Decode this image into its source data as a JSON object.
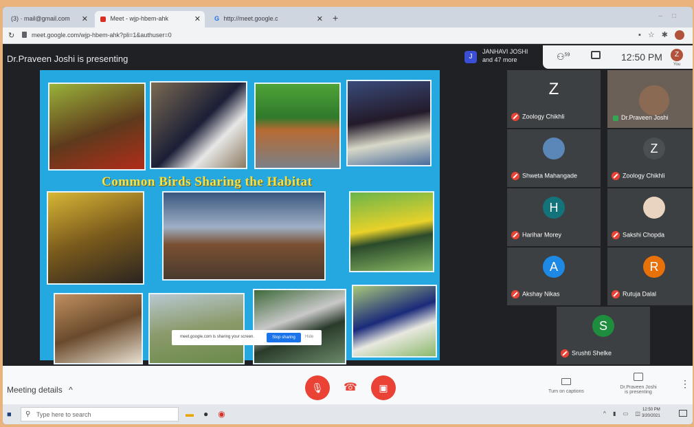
{
  "browser": {
    "tabs": [
      {
        "label": "(3) · mail@gmail.com"
      },
      {
        "label": "Meet - wjp-hbem-ahk"
      },
      {
        "label": "http://meet.google.c"
      }
    ],
    "url": "meet.google.com/wjp-hbem-ahk?pli=1&authuser=0"
  },
  "meet": {
    "presenting_label": "Dr.Praveen Joshi is presenting",
    "people_name": "JANHAVI JOSHI",
    "people_more": "and 47 more",
    "people_avatar": "J",
    "participant_count": "59",
    "clock": "12:50 PM",
    "you_avatar": "Z",
    "you_label": "You"
  },
  "slide": {
    "title": "Common Birds Sharing the Habitat",
    "share_notice": "meet.google.com is sharing your screen.",
    "stop_label": "Stop sharing",
    "hide_label": "Hide"
  },
  "participants": [
    {
      "name": "Zoology Chikhli",
      "initial": "Z",
      "color": "#3c4043",
      "muted": true
    },
    {
      "name": "Dr.Praveen Joshi",
      "initial": "",
      "color": "#5a5048",
      "muted": false
    },
    {
      "name": "Shweta Mahangade",
      "initial": "",
      "color": "#5b86b8",
      "muted": true
    },
    {
      "name": "Zoology Chikhli",
      "initial": "Z",
      "color": "#4a4f52",
      "muted": true
    },
    {
      "name": "Harihar Morey",
      "initial": "H",
      "color": "#12737a",
      "muted": true
    },
    {
      "name": "Sakshi Chopda",
      "initial": "",
      "color": "#e9d4c2",
      "muted": true
    },
    {
      "name": "Akshay Nikas",
      "initial": "A",
      "color": "#1e88e5",
      "muted": true
    },
    {
      "name": "Rutuja Dalal",
      "initial": "R",
      "color": "#e8710a",
      "muted": true
    },
    {
      "name": "Srushti Shelke",
      "initial": "S",
      "color": "#1e8e3e",
      "muted": true
    }
  ],
  "bottom": {
    "meeting_details": "Meeting details",
    "captions": "Turn on captions",
    "presenter_line1": "Dr.Praveen Joshi",
    "presenter_line2": "is presenting"
  },
  "taskbar": {
    "search_placeholder": "Type here to search",
    "time": "12:50 PM",
    "date": "3/20/2021"
  }
}
